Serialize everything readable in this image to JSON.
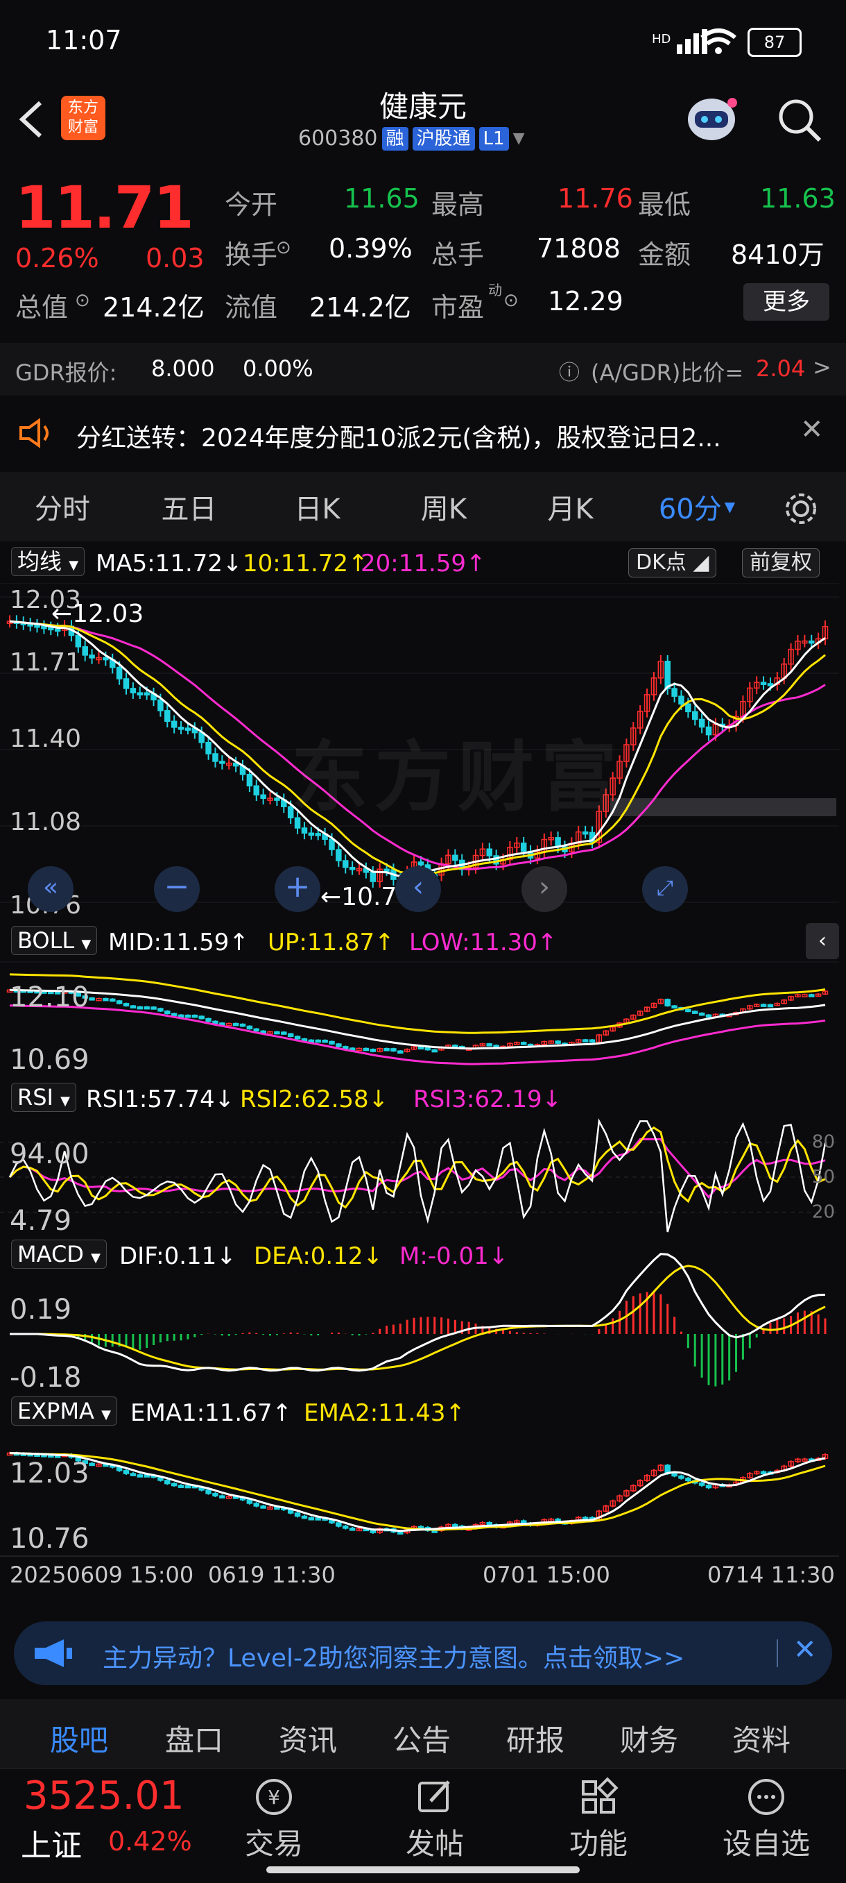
{
  "status_bar": {
    "time": "11:07",
    "battery": "87"
  },
  "header": {
    "back_label": "<",
    "logo_line1": "东方",
    "logo_line2": "财富",
    "stock_name": "健康元",
    "stock_code": "600380",
    "tags": [
      "融",
      "沪股通",
      "L1"
    ]
  },
  "quote": {
    "price": "11.71",
    "change_pct": "0.26%",
    "change": "0.03",
    "open_label": "今开",
    "open": "11.65",
    "high_label": "最高",
    "high": "11.76",
    "low_label": "最低",
    "low": "11.63",
    "turnover_label": "换手",
    "turnover": "0.39%",
    "volume_label": "总手",
    "volume": "71808",
    "amount_label": "金额",
    "amount": "8410万",
    "mktcap_label": "总值",
    "mktcap": "214.2亿",
    "float_label": "流值",
    "float": "214.2亿",
    "pe_label": "市盈",
    "pe_sup": "动",
    "pe": "12.29",
    "more_button": "更多"
  },
  "gdr": {
    "label": "GDR报价:",
    "price": "8.000",
    "pct": "0.00%",
    "ratio_label": "(A/GDR)比价=",
    "ratio": "2.04",
    "arrow": ">"
  },
  "notice": {
    "text": "分红送转：2024年度分配10派2元(含税)，股权登记日2..."
  },
  "chart_tabs": {
    "items": [
      "分时",
      "五日",
      "日K",
      "周K",
      "月K",
      "60分"
    ],
    "active": "60分"
  },
  "main_chart": {
    "ma_label": "均线",
    "ma5": "MA5:11.72",
    "ma10": "10:11.72",
    "ma20": "20:11.59",
    "dk_button": "DK点",
    "adjust_button": "前复权",
    "y_labels": [
      "12.03",
      "11.71",
      "11.40",
      "11.08",
      "10.76"
    ],
    "high_annotation": "←12.03",
    "low_annotation": "←10.76",
    "watermark": "东方财富"
  },
  "boll": {
    "label": "BOLL",
    "mid": "MID:11.59",
    "up": "UP:11.87",
    "low": "LOW:11.30",
    "y_labels": [
      "12.10",
      "10.69"
    ]
  },
  "rsi": {
    "label": "RSI",
    "rsi1": "RSI1:57.74",
    "rsi2": "RSI2:62.58",
    "rsi3": "RSI3:62.19",
    "y_labels": [
      "94.00",
      "4.79"
    ],
    "levels": [
      "80",
      "50",
      "20"
    ]
  },
  "macd": {
    "label": "MACD",
    "dif": "DIF:0.11",
    "dea": "DEA:0.12",
    "m": "M:-0.01",
    "y_labels": [
      "0.19",
      "-0.18"
    ]
  },
  "expma": {
    "label": "EXPMA",
    "ema1": "EMA1:11.67",
    "ema2": "EMA2:11.43",
    "y_labels": [
      "12.03",
      "10.76"
    ]
  },
  "x_axis": {
    "labels": [
      "20250609 15:00",
      "0619 11:30",
      "0701 15:00",
      "0714 11:30"
    ]
  },
  "promo": {
    "text": "主力异动？Level-2助您洞察主力意图。点击领取>>"
  },
  "info_tabs": {
    "items": [
      "股吧",
      "盘口",
      "资讯",
      "公告",
      "研报",
      "财务",
      "资料"
    ],
    "active": "股吧"
  },
  "bottom_bar": {
    "index_value": "3525.01",
    "index_name": "上证",
    "index_pct": "0.42%",
    "actions": [
      "交易",
      "发帖",
      "功能",
      "设自选"
    ]
  },
  "colors": {
    "up": "#ff2d2d",
    "down": "#16c24d",
    "accent": "#3a8bff",
    "ma5": "#ffffff",
    "ma10": "#ffe400",
    "ma20": "#ff2bd0"
  }
}
